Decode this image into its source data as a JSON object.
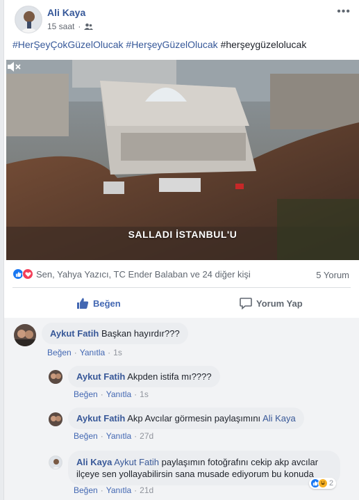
{
  "post": {
    "author": "Ali Kaya",
    "time": "15 saat",
    "hashtags": [
      "#HerŞeyÇokGüzelOlucak",
      "#HerşeyGüzelOlucak",
      "#herşeygüzelolucak"
    ],
    "video_caption": "SALLADI İSTANBUL'U"
  },
  "reactions": {
    "summary": "Sen, Yahya Yazıcı, TC Ender Balaban ve 24 diğer kişi",
    "comment_count": "5 Yorum"
  },
  "actions": {
    "like": "Beğen",
    "comment": "Yorum Yap"
  },
  "comments": [
    {
      "name": "Aykut Fatih",
      "text": "Başkan hayırdır???",
      "like": "Beğen",
      "reply": "Yanıtla",
      "time": "1s"
    },
    {
      "name": "Aykut Fatih",
      "text": "Akpden istifa mı????",
      "like": "Beğen",
      "reply": "Yanıtla",
      "time": "1s"
    },
    {
      "name": "Aykut Fatih",
      "text": "Akp Avcılar görmesin paylaşımını",
      "mention": "Ali Kaya",
      "like": "Beğen",
      "reply": "Yanıtla",
      "time": "27d"
    },
    {
      "name": "Ali Kaya",
      "mention": "Aykut Fatih",
      "text": "paylaşımın fotoğrafını cekip akp avcılar",
      "text2": "ilçeye sen yollayabilirsin sana musade ediyorum bu konuda",
      "like": "Beğen",
      "reply": "Yanıtla",
      "time": "21d",
      "reaction_count": "2"
    }
  ],
  "separator": "·",
  "colors": {
    "link": "#365899",
    "accent": "#4267b2",
    "muted": "#606770"
  }
}
